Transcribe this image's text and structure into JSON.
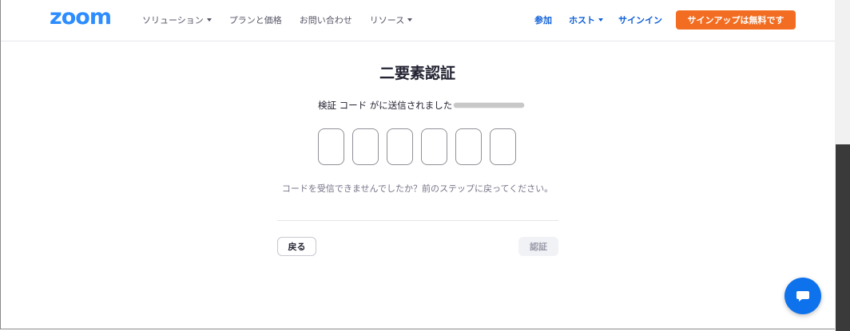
{
  "header": {
    "logo": "zoom",
    "nav_left": [
      {
        "label": "ソリューション",
        "caret": true
      },
      {
        "label": "プランと価格",
        "caret": false
      },
      {
        "label": "お問い合わせ",
        "caret": false
      },
      {
        "label": "リソース",
        "caret": true
      }
    ],
    "join": "参加",
    "host": "ホスト",
    "signin": "サインイン",
    "signup": "サインアップは無料です"
  },
  "main": {
    "title": "二要素認証",
    "sent_text": "検証 コード がに送信されました",
    "code_boxes": 6,
    "help_text": "コードを受信できませんでしたか？前のステップに戻ってください。",
    "back_label": "戻る",
    "verify_label": "認証"
  },
  "colors": {
    "brand": "#2d8cff",
    "link": "#0e5fd8",
    "signup_bg": "#f26d21",
    "chat_bg": "#0e72ed"
  },
  "icons": {
    "chat": "chat-bubble-icon"
  }
}
